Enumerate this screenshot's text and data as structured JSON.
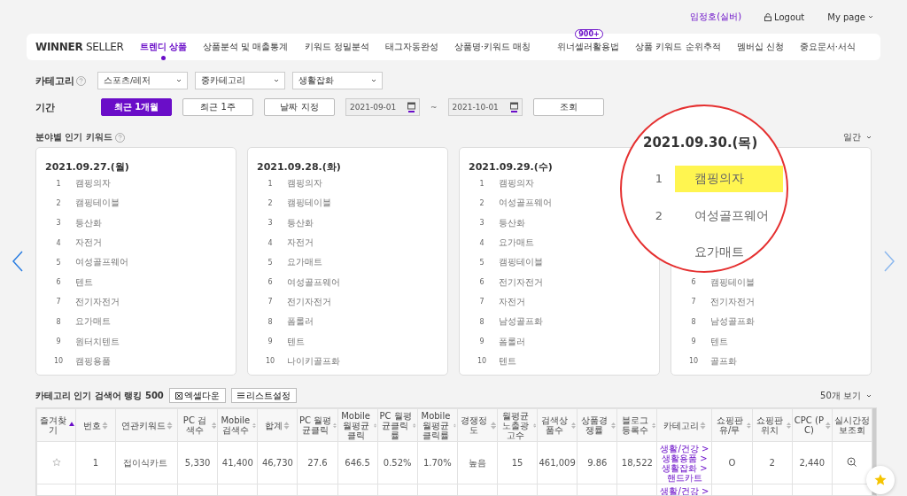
{
  "top_bar": {
    "user": "임정호(실버)",
    "logout": "Logout",
    "mypage": "My page"
  },
  "nav": {
    "logo_bold": "WINNER",
    "logo_light": "SELLER",
    "left_items": [
      {
        "label": "트렌디 상품",
        "selected": true
      },
      {
        "label": "상품분석 및 매출통계",
        "selected": false
      },
      {
        "label": "키워드 정밀분석",
        "selected": false
      },
      {
        "label": "태그자동완성",
        "selected": false
      },
      {
        "label": "상품명·키워드 매칭",
        "selected": false
      }
    ],
    "right_items": [
      {
        "label": "위너셀러활용법",
        "badge": "900+"
      },
      {
        "label": "상품 키워드 순위추적"
      },
      {
        "label": "멤버십 신청"
      },
      {
        "label": "중요문서·서식"
      }
    ]
  },
  "filters": {
    "category_label": "카테고리",
    "selects": [
      "스포츠/레저",
      "중카테고리",
      "생활잡화"
    ],
    "period_label": "기간",
    "period_buttons": [
      {
        "label": "최근 1개월",
        "selected": true
      },
      {
        "label": "최근 1주",
        "selected": false
      },
      {
        "label": "날짜 지정",
        "selected": false
      }
    ],
    "date_from": "2021-09-01",
    "date_sep": "~",
    "date_to": "2021-10-01",
    "search_button": "조회"
  },
  "popular": {
    "title": "분야별 인기 키워드",
    "period": "일간",
    "cards": [
      {
        "date": "2021.09.27.(월)",
        "items": [
          {
            "rank": "1",
            "name": "캠핑의자"
          },
          {
            "rank": "2",
            "name": "캠핑테이블"
          },
          {
            "rank": "3",
            "name": "등산화"
          },
          {
            "rank": "4",
            "name": "자전거"
          },
          {
            "rank": "5",
            "name": "여성골프웨어"
          },
          {
            "rank": "6",
            "name": "텐트"
          },
          {
            "rank": "7",
            "name": "전기자전거"
          },
          {
            "rank": "8",
            "name": "요가매트"
          },
          {
            "rank": "9",
            "name": "원터치텐트"
          },
          {
            "rank": "10",
            "name": "캠핑용품"
          }
        ]
      },
      {
        "date": "2021.09.28.(화)",
        "items": [
          {
            "rank": "1",
            "name": "캠핑의자"
          },
          {
            "rank": "2",
            "name": "캠핑테이블"
          },
          {
            "rank": "3",
            "name": "등산화"
          },
          {
            "rank": "4",
            "name": "자전거"
          },
          {
            "rank": "5",
            "name": "요가매트"
          },
          {
            "rank": "6",
            "name": "여성골프웨어"
          },
          {
            "rank": "7",
            "name": "전기자전거"
          },
          {
            "rank": "8",
            "name": "폼롤러"
          },
          {
            "rank": "9",
            "name": "텐트"
          },
          {
            "rank": "10",
            "name": "나이키골프화"
          }
        ]
      },
      {
        "date": "2021.09.29.(수)",
        "items": [
          {
            "rank": "1",
            "name": "캠핑의자"
          },
          {
            "rank": "2",
            "name": "여성골프웨어"
          },
          {
            "rank": "3",
            "name": "등산화"
          },
          {
            "rank": "4",
            "name": "요가매트"
          },
          {
            "rank": "5",
            "name": "캠핑테이블"
          },
          {
            "rank": "6",
            "name": "전기자전거"
          },
          {
            "rank": "7",
            "name": "자전거"
          },
          {
            "rank": "8",
            "name": "남성골프화"
          },
          {
            "rank": "9",
            "name": "폼롤러"
          },
          {
            "rank": "10",
            "name": "텐트"
          }
        ]
      },
      {
        "items": [
          {
            "rank": "6",
            "name": "캠핑테이블"
          },
          {
            "rank": "7",
            "name": "전기자전거"
          },
          {
            "rank": "8",
            "name": "남성골프화"
          },
          {
            "rank": "9",
            "name": "텐트"
          },
          {
            "rank": "10",
            "name": "골프화"
          }
        ]
      }
    ],
    "magnifier": {
      "date": "2021.09.30.(목)",
      "rows": [
        {
          "rank": "1",
          "name": "캠핑의자",
          "highlighted": true
        },
        {
          "rank": "2",
          "name": "여성골프웨어",
          "highlighted": false
        },
        {
          "name": "요가매트",
          "highlighted": false
        }
      ]
    }
  },
  "ranking": {
    "title": "카테고리 인기 검색어 랭킹 500",
    "excel_button": "엑셀다운",
    "list_button": "리스트설정",
    "page_size": "50개 보기",
    "columns": [
      {
        "label": "즐겨찾기",
        "sortable": true,
        "sorted": true
      },
      {
        "label": "번호",
        "sortable": true,
        "sorted": false
      },
      {
        "label": "연관키워드",
        "sortable": true,
        "sorted": false
      },
      {
        "label": "PC 검색수",
        "sortable": true,
        "sorted": false
      },
      {
        "label": "Mobile 검색수",
        "sortable": true,
        "sorted": false
      },
      {
        "label": "합계",
        "sortable": true,
        "sorted": false
      },
      {
        "label": "PC 월평균클릭",
        "sortable": true,
        "sorted": false
      },
      {
        "label": "Mobile 월평균클릭",
        "sortable": true,
        "sorted": false
      },
      {
        "label": "PC 월평균클릭률",
        "sortable": true,
        "sorted": false
      },
      {
        "label": "Mobile 월평균클릭률",
        "sortable": true,
        "sorted": false
      },
      {
        "label": "경쟁정도",
        "sortable": true,
        "sorted": false
      },
      {
        "label": "월평균노출광고수",
        "sortable": true,
        "sorted": false
      },
      {
        "label": "검색상품수",
        "sortable": true,
        "sorted": false
      },
      {
        "label": "상품경쟁률",
        "sortable": true,
        "sorted": false
      },
      {
        "label": "블로그등록수",
        "sortable": true,
        "sorted": false
      },
      {
        "label": "카테고리",
        "sortable": true,
        "sorted": false
      },
      {
        "label": "쇼핑판유/무",
        "sortable": true,
        "sorted": false
      },
      {
        "label": "쇼핑판위치",
        "sortable": true,
        "sorted": false
      },
      {
        "label": "CPC (PC)",
        "sortable": true,
        "sorted": false
      },
      {
        "label": "실시간정보조회",
        "sortable": false
      }
    ],
    "rows": [
      {
        "favorite": false,
        "cells": [
          "1",
          "접이식카트",
          "5,330",
          "41,400",
          "46,730",
          "27.6",
          "646.5",
          "0.52%",
          "1.70%",
          "높음",
          "15",
          "461,009",
          "9.86",
          "18,522"
        ],
        "category": [
          "생활/건강 >",
          "생활용품 >",
          "생활잡화 >",
          "핸드카트"
        ],
        "cells_after": [
          "O",
          "2",
          "2,440"
        ],
        "lookup": true
      },
      {
        "category": [
          "생활/건강 >"
        ]
      }
    ]
  }
}
